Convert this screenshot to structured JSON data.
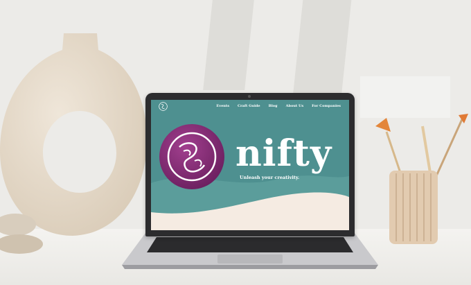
{
  "colors": {
    "screen_teal": "#4e9090",
    "wave_light": "#f5ebe2",
    "logo_purple": "#8a2f7c",
    "text_white": "#ffffff"
  },
  "site": {
    "nav": [
      "Events",
      "Craft Guide",
      "Blog",
      "About Us",
      "For Companies"
    ],
    "brand": "nifty",
    "tagline": "Unleash your creativity."
  },
  "icons": {
    "nav_logo": "brain-swirl-icon",
    "hero_logo": "brain-swirl-icon"
  }
}
